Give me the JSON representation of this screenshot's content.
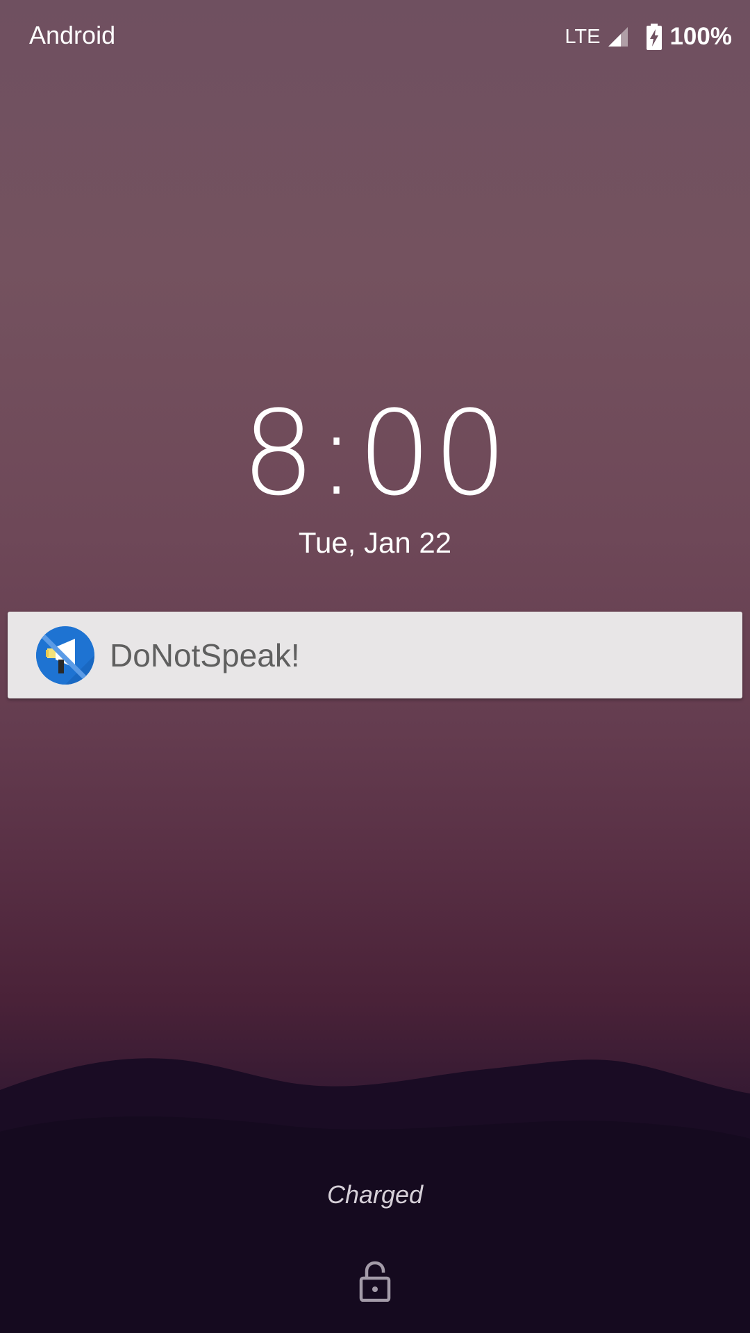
{
  "status_bar": {
    "carrier": "Android",
    "network_type": "LTE",
    "battery_percent": "100%",
    "signal_icon": "cell-signal-icon",
    "battery_icon": "battery-charging-icon"
  },
  "lockscreen": {
    "time": "8:00",
    "date": "Tue, Jan 22",
    "charging_status": "Charged",
    "lock_icon": "lock-icon"
  },
  "notification": {
    "app_icon": "megaphone-muted-icon",
    "title": "DoNotSpeak!"
  },
  "colors": {
    "notification_background": "#e8e6e7",
    "app_icon_accent": "#1e73d2"
  }
}
